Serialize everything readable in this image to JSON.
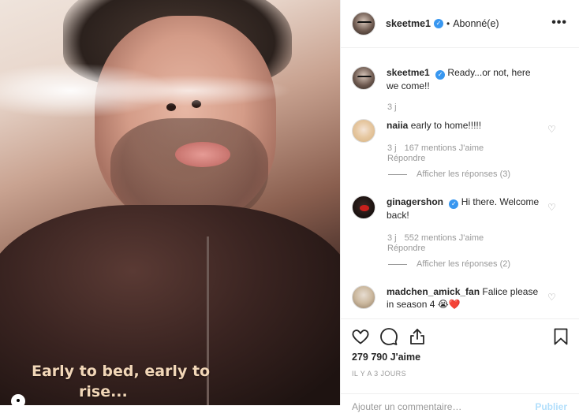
{
  "photo": {
    "caption_line1": "Early to bed, early to",
    "caption_line2": "rise..."
  },
  "header": {
    "username": "skeetme1",
    "separator": "•",
    "follow_status": "Abonné(e)",
    "more": "•••"
  },
  "comments": [
    {
      "username": "skeetme1",
      "text": "Ready...or not, here we come!!",
      "time": "3 j"
    },
    {
      "username": "naiia",
      "text": "early to home!!!!!",
      "time": "3 j",
      "likes": "167 mentions J'aime",
      "reply": "Répondre",
      "view_replies": "Afficher les réponses (3)"
    },
    {
      "username": "ginagershon",
      "text": "Hi there. Welcome back!",
      "time": "3 j",
      "likes": "552 mentions J'aime",
      "reply": "Répondre",
      "view_replies": "Afficher les réponses (2)"
    },
    {
      "username": "madchen_amick_fan",
      "text": "Falice please in season 4 😭❤️"
    }
  ],
  "actions": {
    "likes_count": "279 790 J'aime",
    "time_ago": "IL Y A 3 JOURS"
  },
  "add_comment": {
    "placeholder": "Ajouter un commentaire…",
    "publish": "Publier"
  },
  "colors": {
    "verified": "#3897f0",
    "publish_disabled": "#b2dffc",
    "caption": "#f2d7b8"
  }
}
